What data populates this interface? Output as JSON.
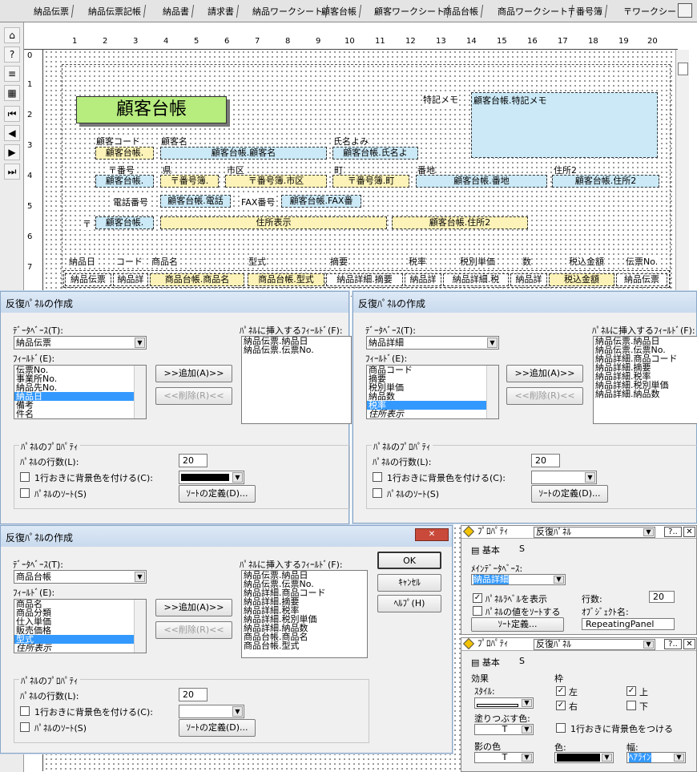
{
  "tabs": [
    "納品伝票",
    "納品伝票記帳",
    "納品書",
    "請求書",
    "納品ワークシート",
    "顧客台帳",
    "顧客ワークシート",
    "商品台帳",
    "商品ワークシート",
    "〒番号簿",
    "〒ワークシート"
  ],
  "active_tab": "顧客台帳",
  "ruler_marks": [
    "1",
    "2",
    "3",
    "4",
    "5",
    "6",
    "7",
    "8",
    "9",
    "10",
    "11",
    "12",
    "13",
    "14",
    "15",
    "16",
    "17",
    "18",
    "19",
    "20"
  ],
  "vruler_marks": [
    "0",
    "1",
    "2",
    "3",
    "4",
    "5",
    "6",
    "7"
  ],
  "layout": {
    "title": "顧客台帳",
    "memo_label": "特記メモ",
    "memo_field": "顧客台帳.特記メモ",
    "labels": {
      "customer_code": "顧客コード",
      "customer_name": "顧客名",
      "name_reading": "氏名よみ",
      "postal": "〒番号",
      "prefecture": "県",
      "city": "市区",
      "town": "町",
      "address_no": "番地",
      "address2": "住所2",
      "phone": "電話番号",
      "fax": "FAX番号",
      "postal_mark": "〒"
    },
    "fields": {
      "customer_code": "顧客台帳.",
      "customer_name": "顧客台帳.顧客名",
      "name_reading": "顧客台帳.氏名よ",
      "postal": "顧客台帳.",
      "prefecture": "〒番号簿.",
      "city": "〒番号簿.市区",
      "town": "〒番号簿.町",
      "address_no": "顧客台帳.番地",
      "address2": "顧客台帳.住所2",
      "phone": "顧客台帳.電話",
      "fax": "顧客台帳.FAX番",
      "postal2": "顧客台帳.",
      "address_display": "住所表示",
      "address2b": "顧客台帳.住所2"
    },
    "column_heads": [
      "納品日",
      "コード",
      "商品名",
      "型式",
      "摘要",
      "税率",
      "税別単価",
      "数",
      "税込金額",
      "伝票No."
    ],
    "panel_cells": [
      "納品伝票",
      "納品詳",
      "商品台帳.商品名",
      "商品台帳.型式",
      "納品詳細.摘要",
      "納品詳",
      "納品詳細.税",
      "納品詳",
      "税込金額",
      "納品伝票"
    ]
  },
  "dialog1": {
    "title": "反復ﾊﾟﾈﾙの作成",
    "db_label": "ﾃﾞｰﾀﾍﾞｰｽ(T):",
    "db_value": "納品伝票",
    "field_label": "ﾌｨｰﾙﾄﾞ(E):",
    "fields": [
      "伝票No.",
      "事業所No.",
      "納品先No.",
      "納品日",
      "備考",
      "件名"
    ],
    "selected": "納品日",
    "insert_label": "ﾊﾟﾈﾙに挿入するﾌｨｰﾙﾄﾞ(F):",
    "insert_fields": [
      "納品伝票.納品日",
      "納品伝票.伝票No."
    ],
    "add_button": ">>追加(A)>>",
    "remove_button": "<<削除(R)<<",
    "props_label": "ﾊﾟﾈﾙのﾌﾟﾛﾊﾟﾃｨ",
    "rows_label": "ﾊﾟﾈﾙの行数(L):",
    "rows_value": "20",
    "alt_bg_label": "1行おきに背景色を付ける(C):",
    "sort_label": "ﾊﾟﾈﾙのｿｰﾄ(S)",
    "sort_def_button": "ｿｰﾄの定義(D)..."
  },
  "dialog2": {
    "title": "反復ﾊﾟﾈﾙの作成",
    "db_label": "ﾃﾞｰﾀﾍﾞｰｽ(T):",
    "db_value": "納品詳細",
    "field_label": "ﾌｨｰﾙﾄﾞ(E):",
    "fields": [
      "商品コード",
      "摘要",
      "税別単価",
      "納品数",
      "税率",
      "住所表示"
    ],
    "selected": "税率",
    "insert_label": "ﾊﾟﾈﾙに挿入するﾌｨｰﾙﾄﾞ(F):",
    "insert_fields": [
      "納品伝票.納品日",
      "納品伝票.伝票No.",
      "納品詳細.商品コード",
      "納品詳細.摘要",
      "納品詳細.税率",
      "納品詳細.税別単価",
      "納品詳細.納品数"
    ],
    "add_button": ">>追加(A)>>",
    "remove_button": "<<削除(R)<<",
    "props_label": "ﾊﾟﾈﾙのﾌﾟﾛﾊﾟﾃｨ",
    "rows_label": "ﾊﾟﾈﾙの行数(L):",
    "rows_value": "20",
    "alt_bg_label": "1行おきに背景色を付ける(C):",
    "sort_label": "ﾊﾟﾈﾙのｿｰﾄ(S)",
    "sort_def_button": "ｿｰﾄの定義(D)..."
  },
  "dialog3": {
    "title": "反復ﾊﾟﾈﾙの作成",
    "db_label": "ﾃﾞｰﾀﾍﾞｰｽ(T):",
    "db_value": "商品台帳",
    "field_label": "ﾌｨｰﾙﾄﾞ(E):",
    "fields": [
      "商品名",
      "商品分類",
      "仕入単価",
      "販売価格",
      "型式",
      "住所表示"
    ],
    "selected": "型式",
    "insert_label": "ﾊﾟﾈﾙに挿入するﾌｨｰﾙﾄﾞ(F):",
    "insert_fields": [
      "納品伝票.納品日",
      "納品伝票.伝票No.",
      "納品詳細.商品コード",
      "納品詳細.摘要",
      "納品詳細.税率",
      "納品詳細.税別単価",
      "納品詳細.納品数",
      "商品台帳.商品名",
      "商品台帳.型式"
    ],
    "add_button": ">>追加(A)>>",
    "remove_button": "<<削除(R)<<",
    "ok_button": "OK",
    "cancel_button": "ｷｬﾝｾﾙ",
    "help_button": "ﾍﾙﾌﾟ(H)",
    "props_label": "ﾊﾟﾈﾙのﾌﾟﾛﾊﾟﾃｨ",
    "rows_label": "ﾊﾟﾈﾙの行数(L):",
    "rows_value": "20",
    "alt_bg_label": "1行おきに背景色を付ける(C):",
    "sort_label": "ﾊﾟﾈﾙのｿｰﾄ(S)",
    "sort_def_button": "ｿｰﾄの定義(D)..."
  },
  "props1": {
    "title": "ﾌﾟﾛﾊﾟﾃｨ",
    "object_type": "反復ﾊﾟﾈﾙ",
    "help_btn": "?..",
    "tab_basic": "基本",
    "tab_script": "S",
    "maindb_label": "ﾒｲﾝﾃﾞｰﾀﾍﾞｰｽ:",
    "maindb_value": "納品詳細",
    "show_label": "ﾊﾟﾈﾙﾗﾍﾞﾙを表示",
    "rows_label": "行数:",
    "rows_value": "20",
    "sort_label": "ﾊﾟﾈﾙの値をｿｰﾄする",
    "objname_label": "ｵﾌﾞｼﾞｪｸﾄ名:",
    "objname_value": "RepeatingPanel",
    "sort_def_button": "ｿｰﾄ定義..."
  },
  "props2": {
    "title": "ﾌﾟﾛﾊﾟﾃｨ",
    "object_type": "反復ﾊﾟﾈﾙ",
    "help_btn": "?..",
    "tab_basic": "基本",
    "tab_script": "S",
    "effect_label": "効果",
    "style_label": "ｽﾀｲﾙ:",
    "fill_label": "塗りつぶす色:",
    "fill_value": "T",
    "shadow_label": "影の色",
    "shadow_value": "T",
    "frame_label": "枠",
    "left_label": "左",
    "top_label": "上",
    "right_label": "右",
    "bottom_label": "下",
    "alt_bg_label": "1行おきに背景色をつける",
    "color_label": "色:",
    "width_label": "幅:",
    "width_value": "ﾍｱﾗｲﾝ"
  },
  "colors": {
    "title_bg": "#b7ec7e",
    "field_yellow": "#fdf3b8",
    "field_blue": "#cbe9f7",
    "selection": "#3399ff",
    "dialog_bg": "#f0f0f0"
  }
}
